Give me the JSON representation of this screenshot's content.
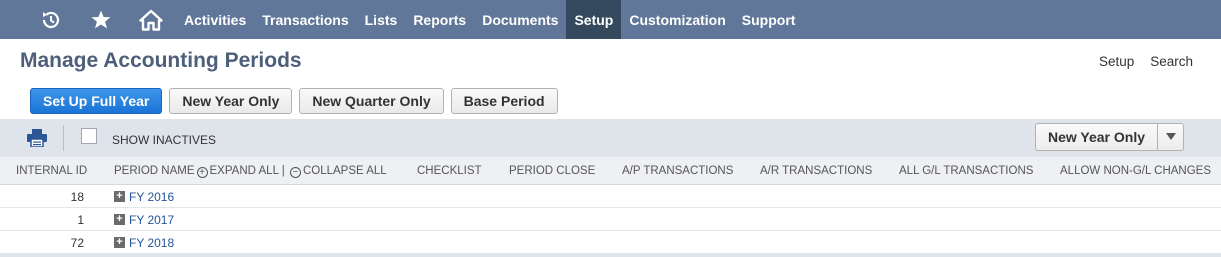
{
  "nav": {
    "icons": [
      "recent-icon",
      "star-icon",
      "home-icon"
    ],
    "items": [
      {
        "label": "Activities",
        "active": false
      },
      {
        "label": "Transactions",
        "active": false
      },
      {
        "label": "Lists",
        "active": false
      },
      {
        "label": "Reports",
        "active": false
      },
      {
        "label": "Documents",
        "active": false
      },
      {
        "label": "Setup",
        "active": true
      },
      {
        "label": "Customization",
        "active": false
      },
      {
        "label": "Support",
        "active": false
      }
    ]
  },
  "page": {
    "title": "Manage Accounting Periods",
    "links": {
      "setup": "Setup",
      "search": "Search"
    }
  },
  "buttons": {
    "setup_full_year": "Set Up Full Year",
    "new_year_only": "New Year Only",
    "new_quarter_only": "New Quarter Only",
    "base_period": "Base Period"
  },
  "filter": {
    "show_inactives": "SHOW INACTIVES",
    "show_inactives_checked": false,
    "dropdown_value": "New Year Only"
  },
  "table": {
    "headers": {
      "internal_id": "INTERNAL ID",
      "period_name": "PERIOD NAME",
      "expand_all": "EXPAND ALL |",
      "collapse_all": "COLLAPSE ALL",
      "checklist": "CHECKLIST",
      "period_close": "PERIOD CLOSE",
      "ap_transactions": "A/P TRANSACTIONS",
      "ar_transactions": "A/R TRANSACTIONS",
      "all_gl_transactions": "ALL G/L TRANSACTIONS",
      "allow_non_gl_changes": "ALLOW NON-G/L CHANGES"
    },
    "rows": [
      {
        "id": "18",
        "name": "FY 2016"
      },
      {
        "id": "1",
        "name": "FY 2017"
      },
      {
        "id": "72",
        "name": "FY 2018"
      }
    ]
  },
  "colors": {
    "nav_bg": "#607799",
    "nav_active": "#34495e",
    "title": "#4d5f79",
    "primary_button": "#1a74d6",
    "link": "#255599",
    "filter_bar": "#dfe4eb"
  }
}
